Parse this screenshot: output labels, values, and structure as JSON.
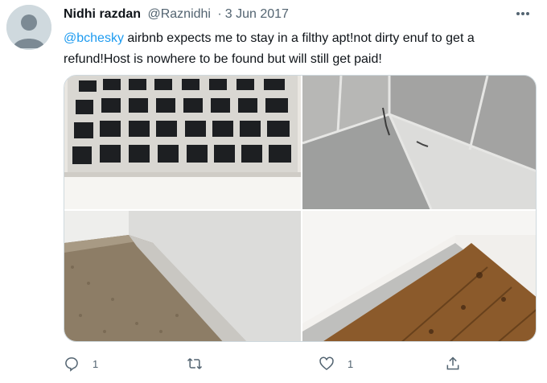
{
  "author": {
    "display_name": "Nidhi razdan",
    "handle": "@Raznidhi",
    "separator": "·",
    "date": "3 Jun 2017"
  },
  "tweet": {
    "mention": "@bchesky",
    "text": " airbnb expects me to stay in a filthy apt!not dirty enuf to get a refund!Host is nowhere to be found but will still get paid!"
  },
  "media": {
    "images": [
      "dirty-vent-photo",
      "dirty-tile-corner-photo",
      "dirty-carpet-baseboard-photo",
      "dirty-floor-baseboard-photo"
    ]
  },
  "actions": {
    "reply_count": "1",
    "retweet_count": "",
    "like_count": "1",
    "share_count": ""
  },
  "icons": {
    "more": "more-dots-icon",
    "reply": "reply-icon",
    "retweet": "retweet-icon",
    "like": "heart-icon",
    "share": "share-icon"
  },
  "colors": {
    "link": "#1d9bf0",
    "muted": "#536471",
    "text": "#0f1419"
  }
}
